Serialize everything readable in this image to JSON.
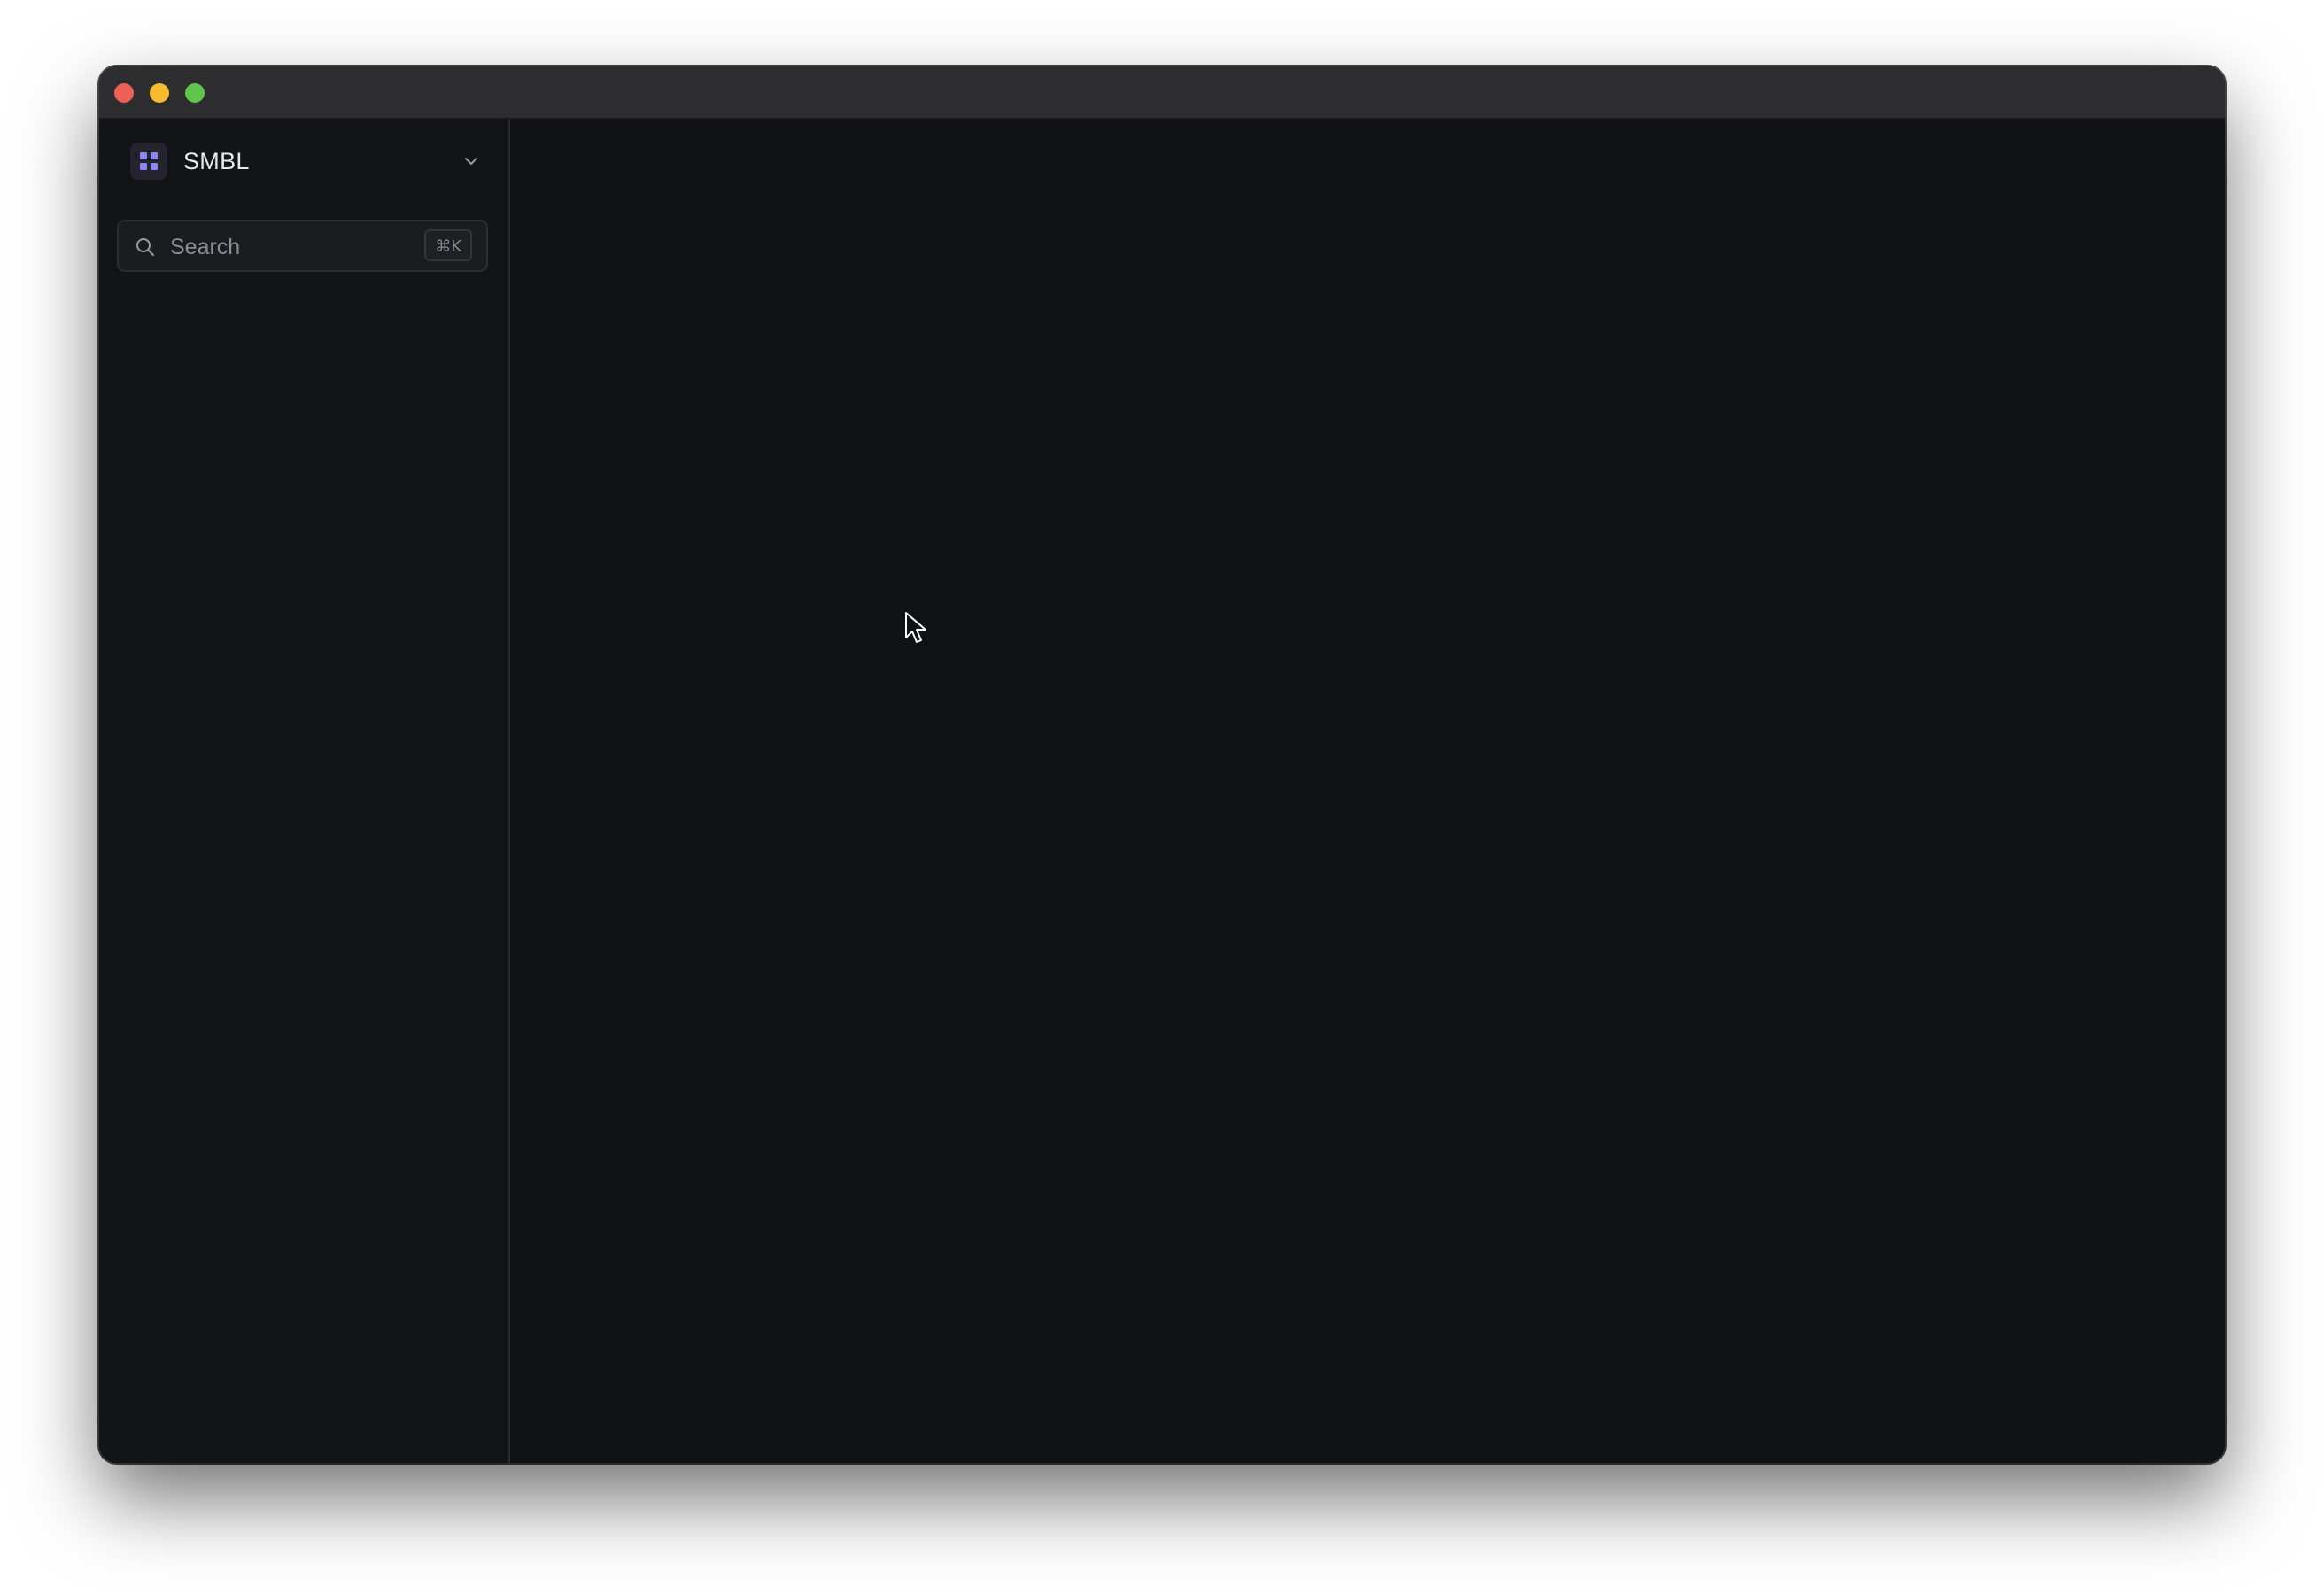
{
  "window": {
    "controls": [
      "close",
      "minimize",
      "maximize"
    ]
  },
  "sidebar": {
    "workspace": {
      "name": "SMBL",
      "icon": "grid-icon",
      "accent": "#8b86f0"
    },
    "search": {
      "placeholder": "Search",
      "shortcut": "⌘K"
    }
  },
  "colors": {
    "background": "#111214",
    "titlebar": "#2d2d2f",
    "close": "#ee5f57",
    "minimize": "#f5bc2f",
    "maximize": "#5ec649"
  }
}
